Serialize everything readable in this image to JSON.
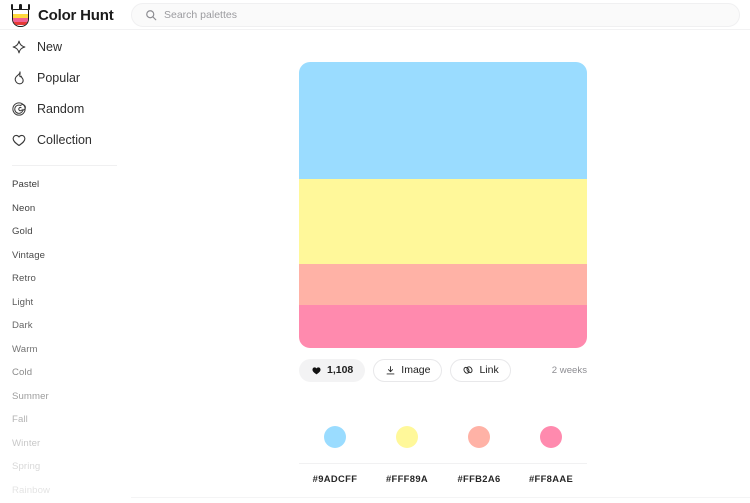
{
  "header": {
    "brand_name": "Color Hunt",
    "logo_icon": "color-hunt-logo",
    "search": {
      "icon": "search-icon",
      "placeholder": "Search palettes",
      "value": ""
    }
  },
  "sidebar": {
    "nav": [
      {
        "label": "New",
        "icon": "sparkle-diamond-icon"
      },
      {
        "label": "Popular",
        "icon": "flame-icon"
      },
      {
        "label": "Random",
        "icon": "spiral-icon"
      },
      {
        "label": "Collection",
        "icon": "heart-outline-icon"
      }
    ],
    "tags": [
      {
        "label": "Pastel",
        "color": "#3a3a3a"
      },
      {
        "label": "Neon",
        "color": "#3f3f3f"
      },
      {
        "label": "Gold",
        "color": "#454545"
      },
      {
        "label": "Vintage",
        "color": "#4b4b4b"
      },
      {
        "label": "Retro",
        "color": "#535353"
      },
      {
        "label": "Light",
        "color": "#5c5c5c"
      },
      {
        "label": "Dark",
        "color": "#666666"
      },
      {
        "label": "Warm",
        "color": "#757575"
      },
      {
        "label": "Cold",
        "color": "#8a8a8a"
      },
      {
        "label": "Summer",
        "color": "#9d9d9d"
      },
      {
        "label": "Fall",
        "color": "#b3b3b3"
      },
      {
        "label": "Winter",
        "color": "#c8c8c8"
      },
      {
        "label": "Spring",
        "color": "#d8d8d8"
      },
      {
        "label": "Rainbow",
        "color": "#e4e4e4"
      }
    ]
  },
  "palette": {
    "colors": [
      {
        "hex": "#9ADCFF",
        "height_pct": 41.0
      },
      {
        "hex": "#FFF89A",
        "height_pct": 29.5
      },
      {
        "hex": "#FFB2A6",
        "height_pct": 14.6
      },
      {
        "hex": "#FF8AAE",
        "height_pct": 14.9
      }
    ],
    "swatches": [
      {
        "hex": "#9ADCFF",
        "label": "#9ADCFF"
      },
      {
        "hex": "#FFF89A",
        "label": "#FFF89A"
      },
      {
        "hex": "#FFB2A6",
        "label": "#FFB2A6"
      },
      {
        "hex": "#FF8AAE",
        "label": "#FF8AAE"
      }
    ],
    "actions": {
      "like": {
        "label": "1,108",
        "icon": "heart-filled-icon"
      },
      "image": {
        "label": "Image",
        "icon": "download-icon"
      },
      "link": {
        "label": "Link",
        "icon": "link-chain-icon"
      }
    },
    "time_ago": "2 weeks"
  }
}
